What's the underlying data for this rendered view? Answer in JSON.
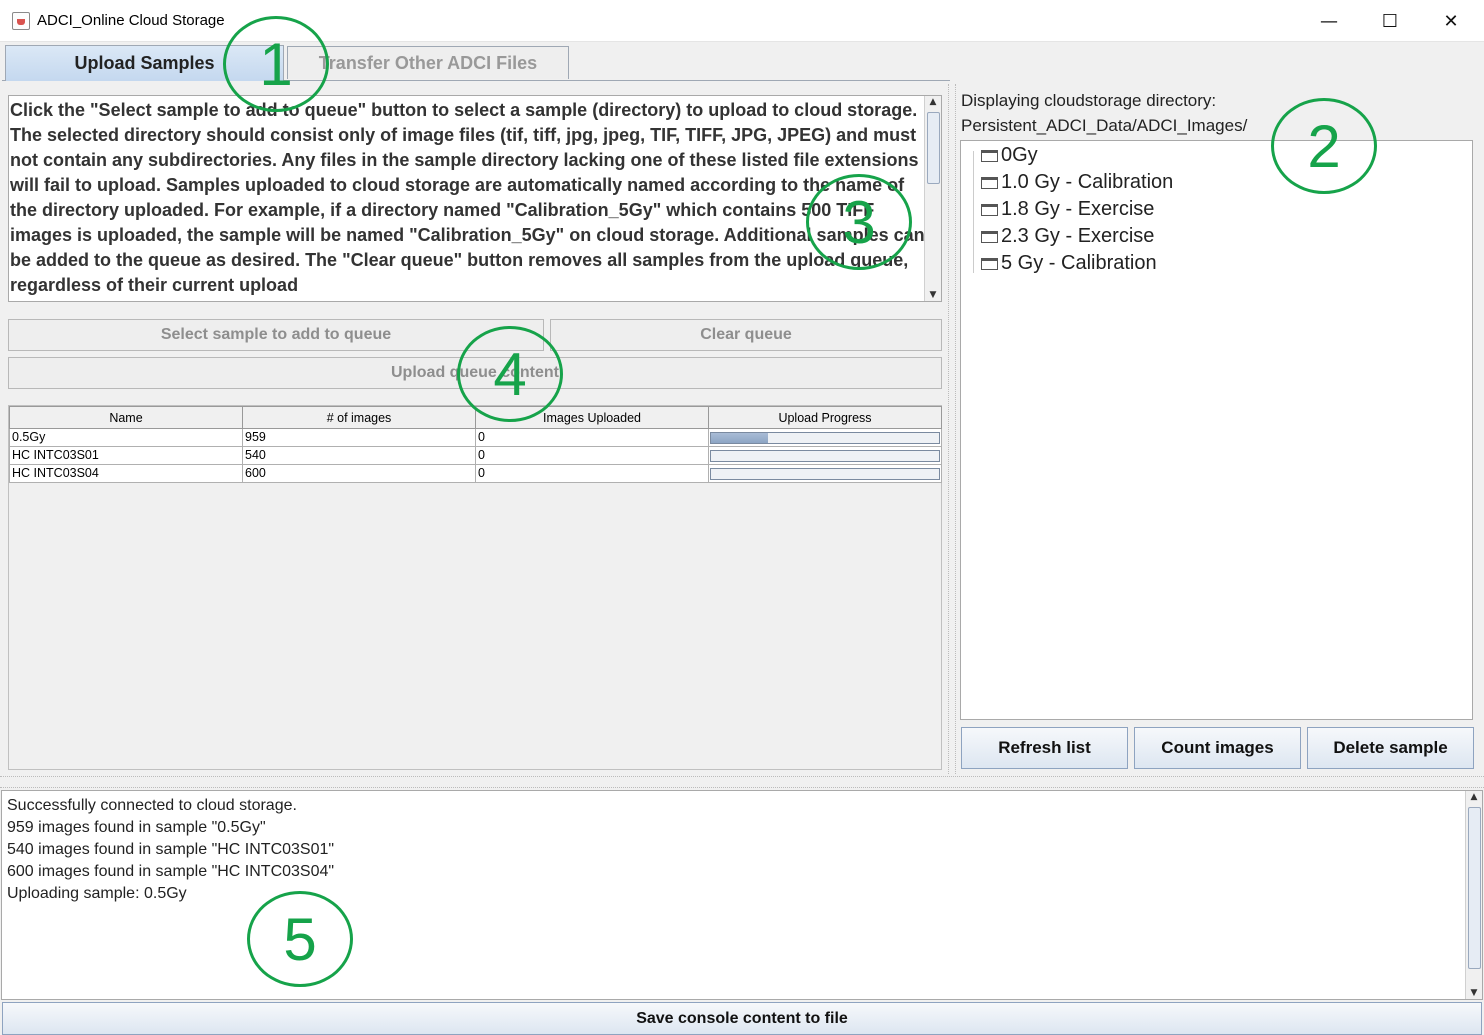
{
  "window": {
    "title": "ADCI_Online Cloud Storage",
    "minimize": "—",
    "maximize": "☐",
    "close": "✕"
  },
  "tabs": [
    {
      "label": "Upload Samples"
    },
    {
      "label": "Transfer Other ADCI Files"
    }
  ],
  "instructions": "Click the \"Select sample to add to queue\" button to select a sample (directory) to upload to cloud storage. The selected directory should consist only of image files (tif, tiff, jpg, jpeg, TIF, TIFF, JPG, JPEG) and must not contain any subdirectories. Any files in the sample directory lacking one of these listed file extensions will fail to upload. Samples uploaded to cloud storage are automatically named according to the name of the directory uploaded. For example, if a directory named \"Calibration_5Gy\" which contains 500 TIFF images is uploaded, the sample will be named \"Calibration_5Gy\" on cloud storage. Additional samples can be added to the queue as desired. The \"Clear queue\" button removes all samples from the upload queue, regardless of their current upload",
  "buttons": {
    "select_sample": "Select sample to add to queue",
    "clear_queue": "Clear queue",
    "upload_queue": "Upload queue content",
    "refresh": "Refresh list",
    "count": "Count images",
    "delete": "Delete sample",
    "save_console": "Save console content to file"
  },
  "queue_table": {
    "columns": [
      "Name",
      "# of images",
      "Images Uploaded",
      "Upload Progress"
    ],
    "rows": [
      {
        "name": "0.5Gy",
        "images": "959",
        "uploaded": "0",
        "progress": 0.25
      },
      {
        "name": "HC INTC03S01",
        "images": "540",
        "uploaded": "0",
        "progress": 0
      },
      {
        "name": "HC INTC03S04",
        "images": "600",
        "uploaded": "0",
        "progress": 0
      }
    ]
  },
  "cloud": {
    "label_line1": "Displaying cloudstorage directory:",
    "label_line2": "Persistent_ADCI_Data/ADCI_Images/",
    "folders": [
      "0Gy",
      "1.0 Gy - Calibration",
      "1.8 Gy - Exercise",
      "2.3 Gy - Exercise",
      "5 Gy - Calibration"
    ]
  },
  "console": {
    "lines": [
      "Successfully connected to cloud storage.",
      "959 images found in sample \"0.5Gy\"",
      "540 images found in sample \"HC INTC03S01\"",
      "600 images found in sample \"HC INTC03S04\"",
      "Uploading sample: 0.5Gy"
    ]
  },
  "annotations": [
    "1",
    "2",
    "3",
    "4",
    "5"
  ],
  "colors": {
    "annotation": "#16a34a",
    "tab_active": "#c4d8ef",
    "progress_fill": "#8da5c4"
  }
}
